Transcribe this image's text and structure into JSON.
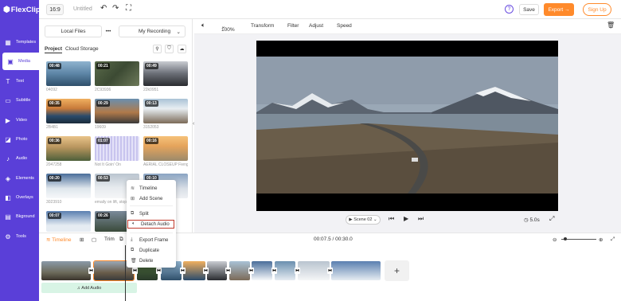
{
  "app": {
    "logo": "FlexClip",
    "ratio": "16:9",
    "project_title": "Untitled",
    "save_label": "Save",
    "export_label": "Export",
    "signup_label": "Sign Up",
    "help_label": "?"
  },
  "nav": [
    {
      "label": "Templates",
      "icon": "templates-icon"
    },
    {
      "label": "Media",
      "icon": "media-icon"
    },
    {
      "label": "Text",
      "icon": "text-icon"
    },
    {
      "label": "Subtitle",
      "icon": "subtitle-icon"
    },
    {
      "label": "Video",
      "icon": "video-icon"
    },
    {
      "label": "Photo",
      "icon": "photo-icon"
    },
    {
      "label": "Audio",
      "icon": "audio-icon"
    },
    {
      "label": "Elements",
      "icon": "elements-icon"
    },
    {
      "label": "Overlays",
      "icon": "overlays-icon"
    },
    {
      "label": "Bkground",
      "icon": "background-icon"
    },
    {
      "label": "Tools",
      "icon": "tools-icon"
    }
  ],
  "panel": {
    "local_files": "Local Files",
    "more": "•••",
    "my_recording": "My Recording",
    "tab_project": "Project",
    "tab_cloud": "Cloud Storage"
  },
  "thumbs": [
    {
      "dur": "00:48",
      "name": "04092"
    },
    {
      "dur": "00:21",
      "name": "2C93936"
    },
    {
      "dur": "00:49",
      "name": "22k0951"
    },
    {
      "dur": "00:35",
      "name": "2B4B1"
    },
    {
      "dur": "00:29",
      "name": "19609"
    },
    {
      "dur": "00:13",
      "name": "3152053"
    },
    {
      "dur": "00:36",
      "name": "2047258"
    },
    {
      "dur": "01:07",
      "name": "Not It Goin' On"
    },
    {
      "dur": "00:16",
      "name": "AERIAL CLOSEUP Fieng..."
    },
    {
      "dur": "00:20",
      "name": "3023910"
    },
    {
      "dur": "00:53",
      "name": "emaily on lift, stopping..."
    },
    {
      "dur": "00:10",
      "name": ""
    },
    {
      "dur": "00:07",
      "name": ""
    },
    {
      "dur": "00:26",
      "name": ""
    }
  ],
  "preview": {
    "zoom": "100%",
    "transform": "Transform",
    "filter": "Filter",
    "adjust": "Adjust",
    "speed": "Speed",
    "scene": "Scene 02",
    "duration": "5.0s"
  },
  "timeline": {
    "timeline_label": "Timeline",
    "trim_label": "Trim",
    "time": "00:07.5 / 00:30.0",
    "add_audio": "Add Audio",
    "add_clip": "+"
  },
  "context_menu": {
    "timeline": "Timeline",
    "add_scene": "Add Scene",
    "split": "Split",
    "detach_audio": "Detach Audio",
    "export_frame": "Export Frame",
    "duplicate": "Duplicate",
    "delete": "Delete"
  },
  "colors": {
    "brand": "#5a3fd8",
    "accent": "#ff8a2b",
    "highlight": "#c0392b"
  }
}
